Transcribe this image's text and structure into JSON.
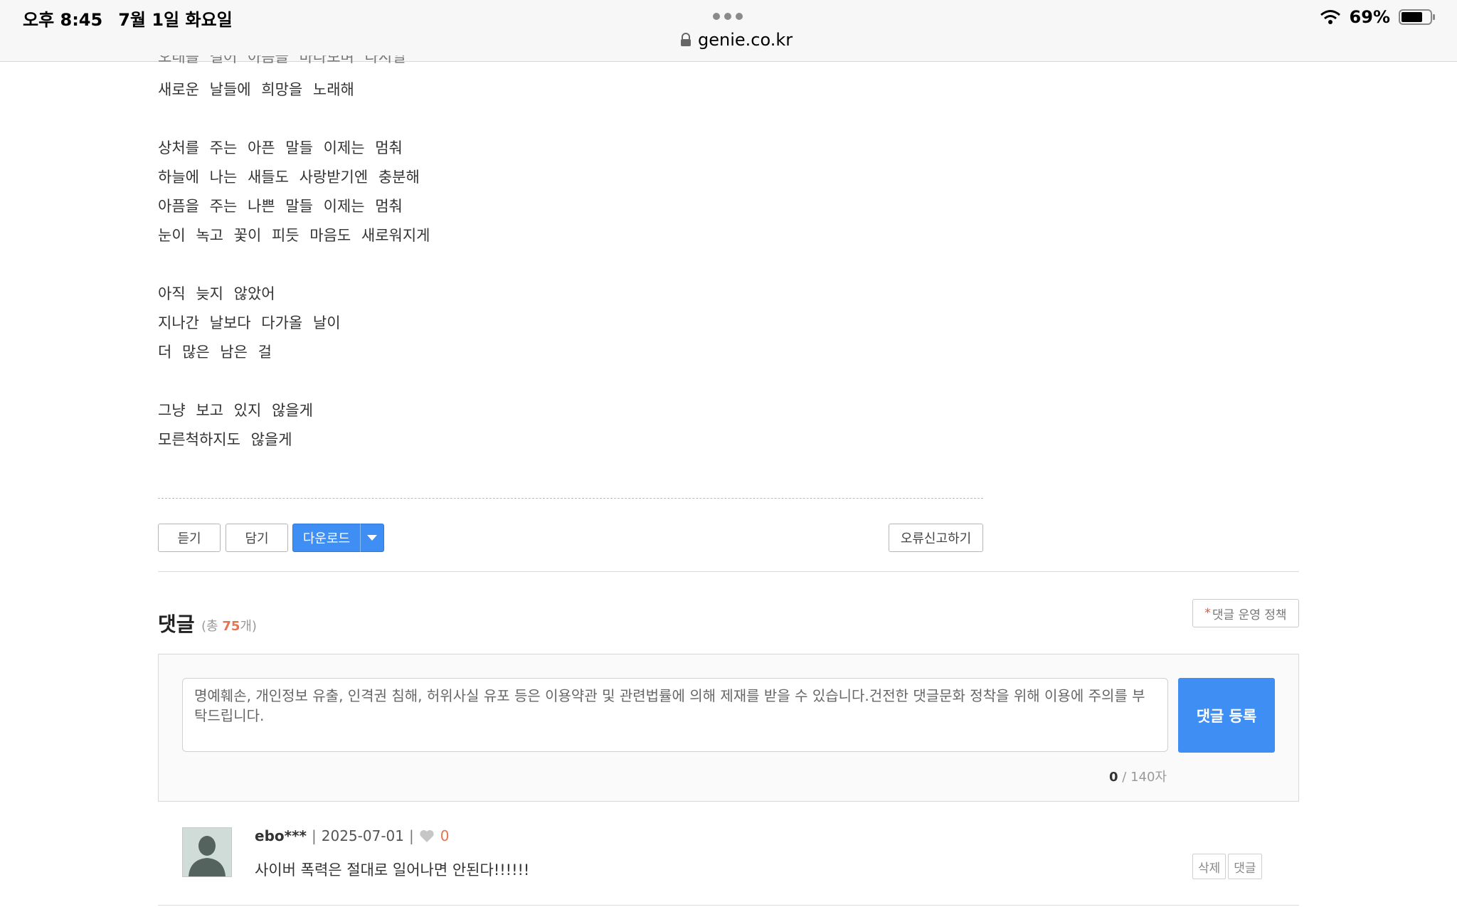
{
  "status_bar": {
    "time": "오후 8:45",
    "date": "7월 1일 화요일",
    "url": "genie.co.kr",
    "battery": "69%"
  },
  "lyrics": {
    "partial_top_line": "오래를 걸어 아픔을 바라보며 다시일",
    "lines": [
      "새로운 날들에 희망을 노래해",
      "",
      "상처를 주는 아픈 말들 이제는 멈춰",
      "하늘에 나는 새들도 사랑받기엔 충분해",
      "아픔을 주는 나쁜 말들 이제는 멈춰",
      "눈이 녹고 꽃이 피듯 마음도 새로워지게",
      "",
      "아직 늦지 않았어",
      "지나간 날보다 다가올 날이",
      "더 많은 남은 걸",
      "",
      "그냥 보고 있지 않을게",
      "모른척하지도 않을게"
    ]
  },
  "actions": {
    "listen": "듣기",
    "save": "담기",
    "download": "다운로드",
    "report": "오류신고하기"
  },
  "comments": {
    "title": "댓글",
    "count_prefix": "(총 ",
    "count": "75",
    "count_suffix": "개)",
    "policy_star": "*",
    "policy": "댓글 운영 정책",
    "placeholder": "명예훼손, 개인정보 유출, 인격권 침해, 허위사실 유포 등은 이용약관 및 관련법률에 의해 제재를 받을 수 있습니다.건전한 댓글문화 정착을 위해 이용에 주의를 부탁드립니다.",
    "submit": "댓글 등록",
    "char_current": "0",
    "char_max": " / 140자",
    "items": [
      {
        "user": "ebo***",
        "date": "2025-07-01",
        "likes": "0",
        "text": "사이버 폭력은 절대로 일어나면 안된다!!!!!!",
        "delete": "삭제",
        "reply": "댓글"
      }
    ]
  }
}
